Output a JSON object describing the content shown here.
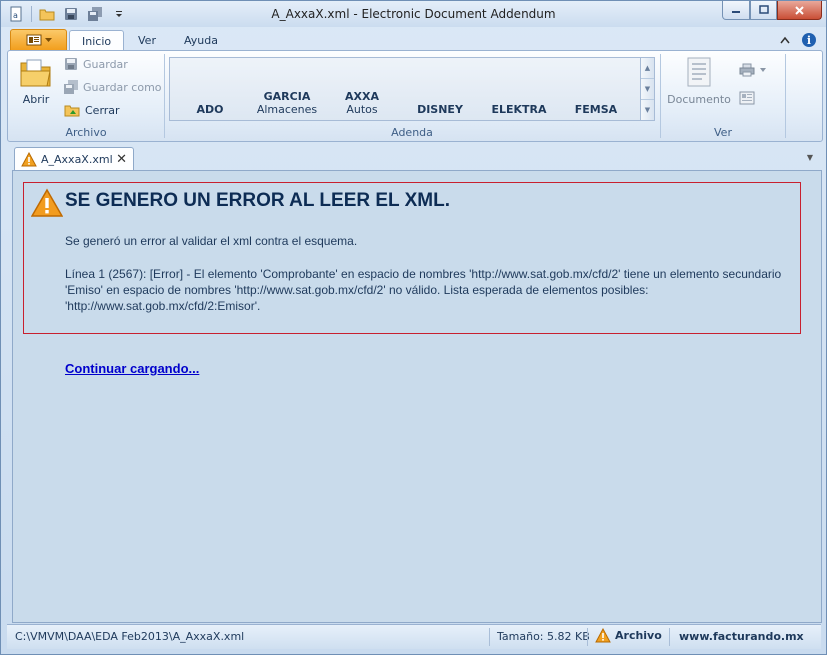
{
  "window": {
    "title": "A_AxxaX.xml - Electronic Document Addendum"
  },
  "ribbon_tabs": [
    "Inicio",
    "Ver",
    "Ayuda"
  ],
  "archivo_group": {
    "label": "Archivo",
    "open_label": "Abrir",
    "save_label": "Guardar",
    "save_as_label": "Guardar como",
    "close_label": "Cerrar"
  },
  "addenda_group": {
    "label": "Adenda",
    "items": [
      {
        "title": "ADO",
        "subtitle": ""
      },
      {
        "title": "GARCIA",
        "subtitle": "Almacenes"
      },
      {
        "title": "AXXA",
        "subtitle": "Autos"
      },
      {
        "title": "DISNEY",
        "subtitle": ""
      },
      {
        "title": "ELEKTRA",
        "subtitle": ""
      },
      {
        "title": "FEMSA",
        "subtitle": ""
      }
    ]
  },
  "ver_group": {
    "label": "Ver",
    "document_label": "Documento"
  },
  "doc_tab": {
    "label": "A_AxxaX.xml"
  },
  "error": {
    "title": "SE GENERO UN ERROR AL LEER EL XML.",
    "description": "Se generó un error al validar el xml contra el esquema.",
    "detail": "Línea 1 (2567): [Error] - El elemento 'Comprobante' en espacio de nombres 'http://www.sat.gob.mx/cfd/2' tiene un elemento secundario 'Emiso' en espacio de nombres 'http://www.sat.gob.mx/cfd/2' no válido. Lista esperada de elementos posibles: 'http://www.sat.gob.mx/cfd/2:Emisor'."
  },
  "continue_link": "Continuar cargando...",
  "status": {
    "path": "C:\\VMVM\\DAA\\EDA Feb2013\\A_AxxaX.xml",
    "size": "Tamaño: 5.82 KB",
    "archivo": "Archivo",
    "website": "www.facturando.mx"
  },
  "colors": {
    "error_border": "#c8202f",
    "link": "#0000cc",
    "warning": "#f0a020",
    "app_button": "#f29e1d"
  }
}
